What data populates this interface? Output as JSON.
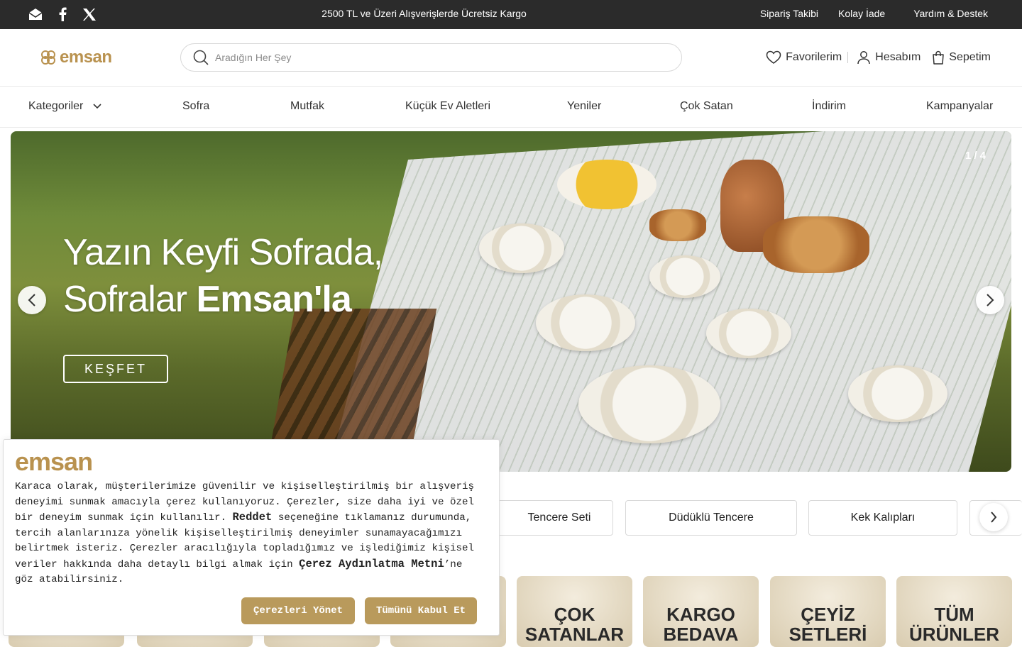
{
  "topbar": {
    "social": [
      "mail-icon",
      "facebook-icon",
      "x-icon"
    ],
    "promo": "2500 TL ve Üzeri Alışverişlerde Ücretsiz Kargo",
    "links": [
      "Sipariş Takibi",
      "Kolay İade",
      "Yardım & Destek"
    ]
  },
  "header": {
    "logo": "emsan",
    "search_placeholder": "Aradığın Her Şey",
    "favorites": "Favorilerim",
    "account": "Hesabım",
    "cart": "Sepetim"
  },
  "nav": [
    "Kategoriler",
    "Sofra",
    "Mutfak",
    "Küçük Ev Aletleri",
    "Yeniler",
    "Çok Satan",
    "İndirim",
    "Kampanyalar"
  ],
  "hero": {
    "line1": "Yazın Keyfi Sofrada,",
    "line2_prefix": "Sofralar ",
    "line2_bold": "Emsan'la",
    "cta": "KEŞFET",
    "counter": "1 / 4"
  },
  "chips": [
    "Tencere Seti",
    "Düdüklü Tencere",
    "Kek Kalıpları"
  ],
  "tiles": [
    "ÇOK SATANLAR",
    "KARGO BEDAVA",
    "ÇEYİZ SETLERİ",
    "TÜM ÜRÜNLER"
  ],
  "cookie": {
    "logo": "emsan",
    "text_1": "Karaca olarak, müşterilerimize güvenilir ve kişiselleştirilmiş bir alışveriş deneyimi sunmak amacıyla çerez kullanıyoruz. Çerezler, size daha iyi ve özel bir deneyim sunmak için kullanılır. ",
    "reject_word": "Reddet",
    "text_2": " seçeneğine tıklamanız durumunda, tercih alanlarınıza yönelik kişiselleştirilmiş deneyimler sunamayacağımızı belirtmek isteriz. Çerezler aracılığıyla topladığımız ve işlediğimiz kişisel veriler hakkında daha detaylı bilgi almak için ",
    "policy_link": "Çerez Aydınlatma Metni",
    "text_3": "’ne göz atabilirsiniz.",
    "manage_button": "Çerezleri Yönet",
    "accept_button": "Tümünü Kabul Et"
  },
  "colors": {
    "brand": "#b9924f",
    "topbar": "#2b2b2b",
    "button": "#b99a5c"
  }
}
